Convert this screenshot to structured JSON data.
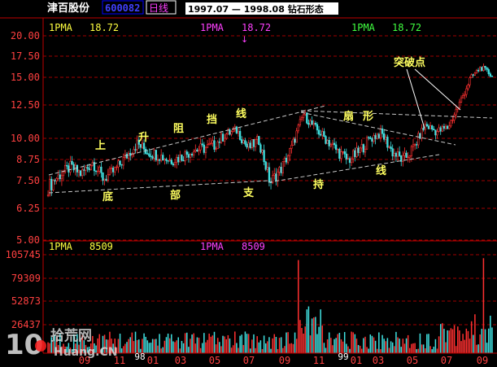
{
  "header": {
    "stock_name": "津百股份",
    "stock_code": "600082",
    "period": "日线",
    "date_range": "1997.07 — 1998.08 钻石形态"
  },
  "colors": {
    "background": "#000000",
    "axis": "#c00000",
    "grid": "#a00000",
    "up_candle": "#ff3030",
    "down_candle": "#40e0e0",
    "pma_yellow": "#ffff40",
    "pma_magenta": "#ff40ff",
    "pma_green": "#40ff40",
    "annotation": "#ffff60",
    "trendline": "#c8c8c8",
    "code_box": "#0000ff"
  },
  "chart_data": [
    {
      "type": "candlestick",
      "legend": [
        {
          "label": "1PMA",
          "value": "18.72",
          "color": "#ffff40"
        },
        {
          "label": "1PMA",
          "value": "18.72",
          "color": "#ff40ff"
        },
        {
          "label": "1PMA",
          "value": "18.72",
          "color": "#40ff40"
        }
      ],
      "y_ticks": [
        "20.00",
        "17.50",
        "15.00",
        "12.50",
        "10.00",
        "8.75",
        "7.50",
        "6.25",
        "5.00"
      ],
      "ylim": [
        5.0,
        20.0
      ],
      "xlim": [
        "1997-07",
        "1998-08"
      ],
      "grid": true,
      "price_series": [
        [
          "1997-07",
          7.2
        ],
        [
          "1997-07",
          7.8
        ],
        [
          "1997-08",
          8.3
        ],
        [
          "1997-08",
          7.9
        ],
        [
          "1997-09",
          8.6
        ],
        [
          "1997-09",
          7.6
        ],
        [
          "1997-10",
          8.1
        ],
        [
          "1997-10",
          8.9
        ],
        [
          "1997-11",
          9.7
        ],
        [
          "1997-11",
          9.2
        ],
        [
          "1997-12",
          9.0
        ],
        [
          "1997-12",
          8.7
        ],
        [
          "1998-01",
          8.9
        ],
        [
          "1998-01",
          9.3
        ],
        [
          "1998-02",
          9.4
        ],
        [
          "1998-02",
          9.6
        ],
        [
          "1998-03",
          10.3
        ],
        [
          "1998-03",
          10.6
        ],
        [
          "1998-04",
          9.4
        ],
        [
          "1998-04",
          9.9
        ],
        [
          "1998-04",
          7.4
        ],
        [
          "1998-05",
          8.2
        ],
        [
          "1998-05",
          9.5
        ],
        [
          "1998-06",
          11.8
        ],
        [
          "1998-06",
          10.8
        ],
        [
          "1998-07",
          10.0
        ],
        [
          "1998-07",
          9.3
        ],
        [
          "1998-07",
          8.7
        ],
        [
          "1998-08",
          9.2
        ],
        [
          "1998-08",
          10.0
        ],
        [
          "1998-09",
          10.4
        ],
        [
          "1998-09",
          9.2
        ],
        [
          "1998-10",
          8.7
        ],
        [
          "1998-10",
          9.5
        ],
        [
          "1998-11",
          11.0
        ],
        [
          "1998-11",
          10.5
        ],
        [
          "1998-12",
          10.8
        ],
        [
          "1998-12",
          12.5
        ],
        [
          "1998-12",
          14.8
        ],
        [
          "1998-12",
          16.2
        ],
        [
          "1998-12",
          15.2
        ]
      ],
      "annotations": [
        {
          "text": "上"
        },
        {
          "text": "升"
        },
        {
          "text": "阻"
        },
        {
          "text": "挡"
        },
        {
          "text": "线"
        },
        {
          "text": "底"
        },
        {
          "text": "部"
        },
        {
          "text": "支"
        },
        {
          "text": "持"
        },
        {
          "text": "线"
        },
        {
          "text": "扇"
        },
        {
          "text": "形"
        },
        {
          "text": "突破点"
        }
      ]
    },
    {
      "type": "bar",
      "legend": [
        {
          "label": "1PMA",
          "value": "8509",
          "color": "#ffff40"
        },
        {
          "label": "1PMA",
          "value": "8509",
          "color": "#ff40ff"
        }
      ],
      "y_ticks": [
        "105745",
        "79309",
        "52873",
        "26437"
      ],
      "ylim": [
        0,
        105745
      ],
      "x_ticks": [
        "09",
        "11",
        "98",
        "01",
        "03",
        "05",
        "07",
        "09",
        "11",
        "99",
        "01",
        "03",
        "05",
        "07",
        "09"
      ],
      "peaks": [
        {
          "month": "1998-09",
          "value": 100000
        },
        {
          "month": "1999-09",
          "value": 102000
        }
      ]
    }
  ],
  "watermark": {
    "num": "10",
    "cn": "拾荒网",
    "en": "Huang.CN"
  }
}
